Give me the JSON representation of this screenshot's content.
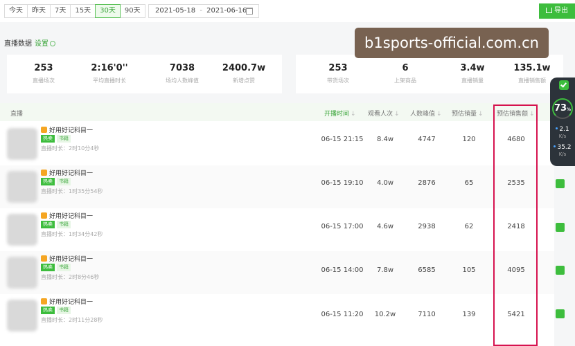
{
  "toolbar": {
    "ranges": [
      "今天",
      "昨天",
      "7天",
      "15天",
      "30天",
      "90天"
    ],
    "active_range": "30天",
    "date_start": "2021-05-18",
    "date_sep": "-",
    "date_end": "2021-06-16",
    "export_label": "导出"
  },
  "section": {
    "title": "直播数据",
    "settings": "设置"
  },
  "stats_left": [
    {
      "value": "253",
      "label": "直播场次"
    },
    {
      "value": "2:16'0''",
      "label": "平均直播时长"
    },
    {
      "value": "7038",
      "label": "场均人数峰值"
    },
    {
      "value": "2400.7w",
      "label": "新增点赞"
    }
  ],
  "stats_right": [
    {
      "value": "253",
      "label": "带货场次"
    },
    {
      "value": "6",
      "label": "上架商品"
    },
    {
      "value": "3.4w",
      "label": "直播销量"
    },
    {
      "value": "135.1w",
      "label": "直播销售额"
    }
  ],
  "watermark": "b1sports-official.com.cn",
  "table": {
    "headers": {
      "live": "直播",
      "start_time": "开播时间",
      "viewers": "观看人次",
      "peak": "人数峰值",
      "sales": "预估销量",
      "amount": "预估销售额"
    },
    "sort_mark": "↓",
    "rows": [
      {
        "title": "好用好记科目一",
        "tag_hot": "热卖",
        "tag_book": "书籍",
        "duration": "直播时长：2时10分4秒",
        "time": "06-15 21:15",
        "viewers": "8.4w",
        "peak": "4747",
        "sales": "120",
        "amount": "4680"
      },
      {
        "title": "好用好记科目一",
        "tag_hot": "热卖",
        "tag_book": "书籍",
        "duration": "直播时长：1时35分54秒",
        "time": "06-15 19:10",
        "viewers": "4.0w",
        "peak": "2876",
        "sales": "65",
        "amount": "2535"
      },
      {
        "title": "好用好记科目一",
        "tag_hot": "热卖",
        "tag_book": "书籍",
        "duration": "直播时长：1时34分42秒",
        "time": "06-15 17:00",
        "viewers": "4.6w",
        "peak": "2938",
        "sales": "62",
        "amount": "2418"
      },
      {
        "title": "好用好记科目一",
        "tag_hot": "热卖",
        "tag_book": "书籍",
        "duration": "直播时长：2时8分46秒",
        "time": "06-15 14:00",
        "viewers": "7.8w",
        "peak": "6585",
        "sales": "105",
        "amount": "4095"
      },
      {
        "title": "好用好记科目一",
        "tag_hot": "热卖",
        "tag_book": "书籍",
        "duration": "直播时长：2时11分28秒",
        "time": "06-15 11:20",
        "viewers": "10.2w",
        "peak": "7110",
        "sales": "139",
        "amount": "5421"
      }
    ]
  },
  "speed_widget": {
    "percent": "73",
    "percent_unit": "%",
    "up": "2.1",
    "up_unit": "K/s",
    "down": "35.2",
    "down_unit": "K/s"
  }
}
